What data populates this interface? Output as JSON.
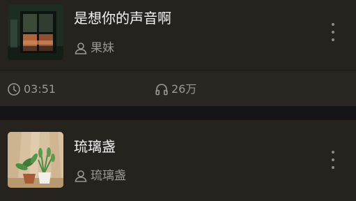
{
  "songs": [
    {
      "title": "是想你的声音啊",
      "artist": "果妹",
      "duration": "03:51",
      "plays": "26万",
      "cover_icon": "window-sunset-cover"
    },
    {
      "title": "琉璃盏",
      "artist": "琉璃盏",
      "cover_icon": "potted-plant-cover"
    }
  ],
  "icons": {
    "artist": "person-icon",
    "duration": "clock-icon",
    "plays": "headphones-icon",
    "more": "more-vertical-icon"
  },
  "colors": {
    "card_background": "#26231f",
    "page_background": "#141416",
    "title_text": "#f2f2f2",
    "secondary_text": "#9c9894"
  }
}
